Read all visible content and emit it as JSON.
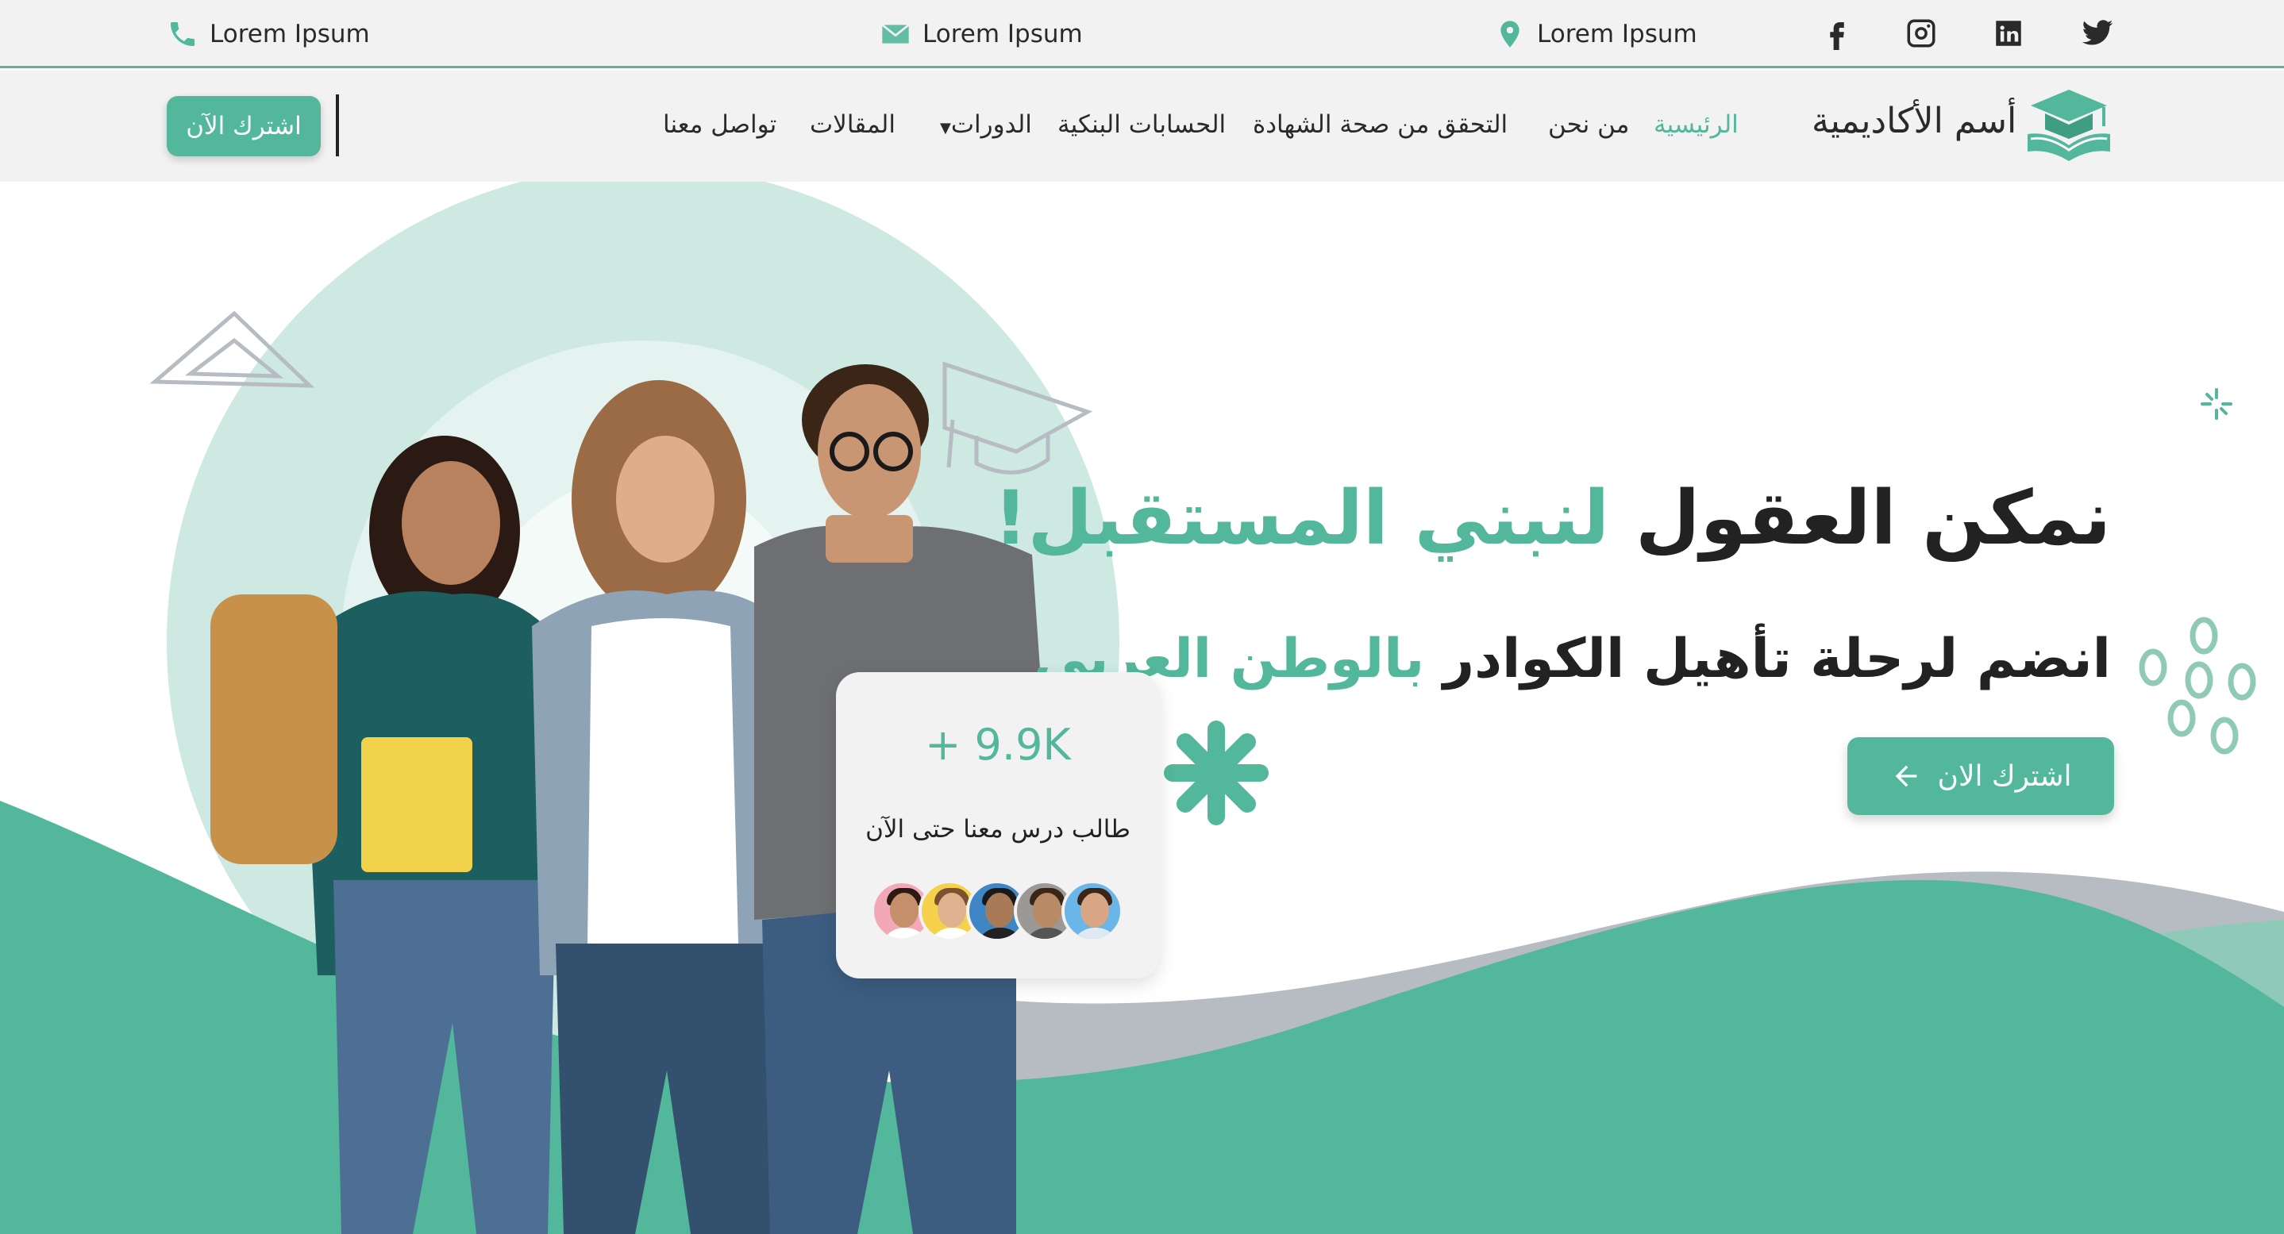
{
  "topbar": {
    "phone": {
      "icon": "phone-icon",
      "text": "Lorem Ipsum"
    },
    "email": {
      "icon": "envelope-icon",
      "text": "Lorem Ipsum"
    },
    "location": {
      "icon": "map-pin-icon",
      "text": "Lorem Ipsum"
    },
    "social": [
      "facebook-icon",
      "instagram-icon",
      "linkedin-icon",
      "twitter-icon"
    ]
  },
  "nav": {
    "cta": "اشترك الآن",
    "items": {
      "home": "الرئيسية",
      "about": "من نحن",
      "verify": "التحقق من صحة الشهادة",
      "bank": "الحسابات البنكية",
      "courses": "الدورات",
      "articles": "المقالات",
      "contact": "تواصل معنا"
    },
    "brand": "أسم الأكاديمية"
  },
  "hero": {
    "headline_main": "نمكن العقول ",
    "headline_accent": "لنبني المستقبل!",
    "subhead_main": "انضم لرحلة تأهيل الكوادر ",
    "subhead_accent": "بالوطن العربي",
    "cta": "اشترك الان",
    "stats": {
      "number": "+ 9.9K",
      "label": "طالب درس معنا حتى الآن"
    }
  },
  "colors": {
    "accent": "#52b79b",
    "light_accent": "#cde9e1",
    "topbar_bg": "#f2f2f2",
    "grey_wave": "#b7bcc2"
  }
}
